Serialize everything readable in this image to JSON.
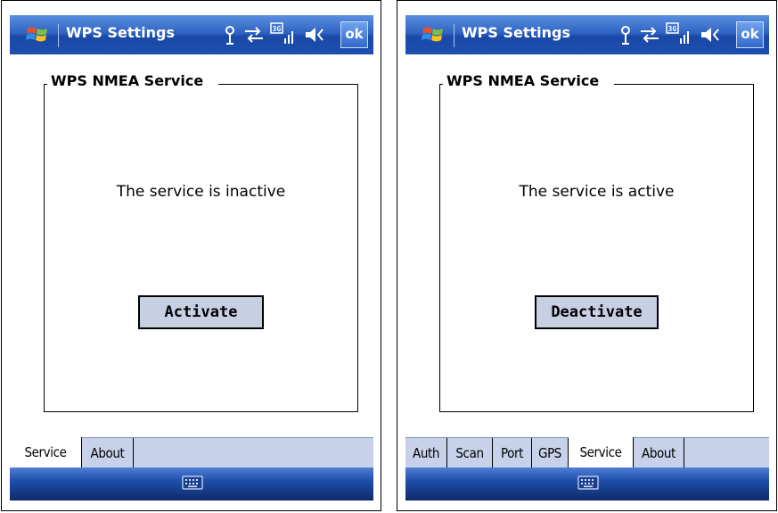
{
  "screens": [
    {
      "window_title": "WPS Settings",
      "ok_label": "ok",
      "group_title": "WPS NMEA Service",
      "status_text": "The service is inactive",
      "action_button": "Activate",
      "tabs": [
        {
          "label": "Service",
          "active": true
        },
        {
          "label": "About",
          "active": false
        }
      ]
    },
    {
      "window_title": "WPS Settings",
      "ok_label": "ok",
      "group_title": "WPS NMEA Service",
      "status_text": "The service is active",
      "action_button": "Deactivate",
      "tabs": [
        {
          "label": "Auth",
          "active": false
        },
        {
          "label": "Scan",
          "active": false
        },
        {
          "label": "Port",
          "active": false
        },
        {
          "label": "GPS",
          "active": false
        },
        {
          "label": "Service",
          "active": true
        },
        {
          "label": "About",
          "active": false
        }
      ]
    }
  ],
  "status_icons": [
    "antenna-icon",
    "sync-arrows-icon",
    "3g-signal-icon",
    "speaker-icon"
  ],
  "colors": {
    "title_bar": "#2f63c3",
    "tab_bar": "#c8d1ea",
    "button_face": "#c7cfe3"
  }
}
